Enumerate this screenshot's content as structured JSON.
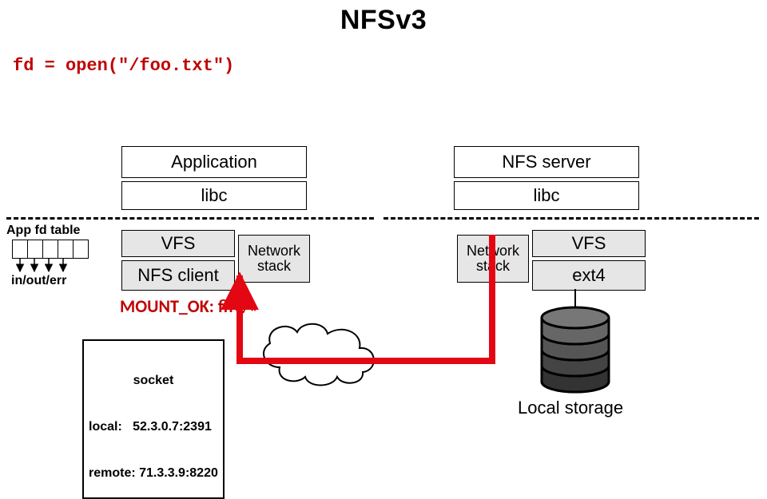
{
  "title": "NFSv3",
  "code": "fd = open(\"/foo.txt\")",
  "client": {
    "application": "Application",
    "libc": "libc",
    "vfs": "VFS",
    "nfs_client": "NFS client",
    "network_stack": "Network\nstack",
    "appfd_label": "App fd table",
    "inouterr": "in/out/err",
    "mount_ok": "MOUNT_OK: fh«/»"
  },
  "server": {
    "nfs_server": "NFS server",
    "libc": "libc",
    "network_stack": "Network\nstack",
    "vfs": "VFS",
    "ext4": "ext4",
    "storage_caption": "Local storage"
  },
  "network_label": "Network",
  "socket": {
    "heading": "socket",
    "local": "local:   52.3.0.7:2391",
    "remote": "remote: 71.3.3.9:8220"
  }
}
